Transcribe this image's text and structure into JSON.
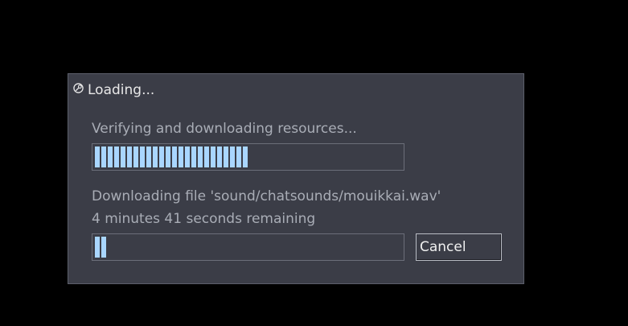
{
  "dialog": {
    "title": "Loading...",
    "icon": "steam-icon",
    "accent_color": "#a9d6ff",
    "overall": {
      "status_text": "Verifying and downloading resources...",
      "progress": 0.495
    },
    "file": {
      "status_text": "Downloading file 'sound/chatsounds/mouikkai.wav'",
      "time_remaining": "4 minutes 41 seconds remaining",
      "progress": 0.05
    },
    "cancel_label": "Cancel"
  }
}
